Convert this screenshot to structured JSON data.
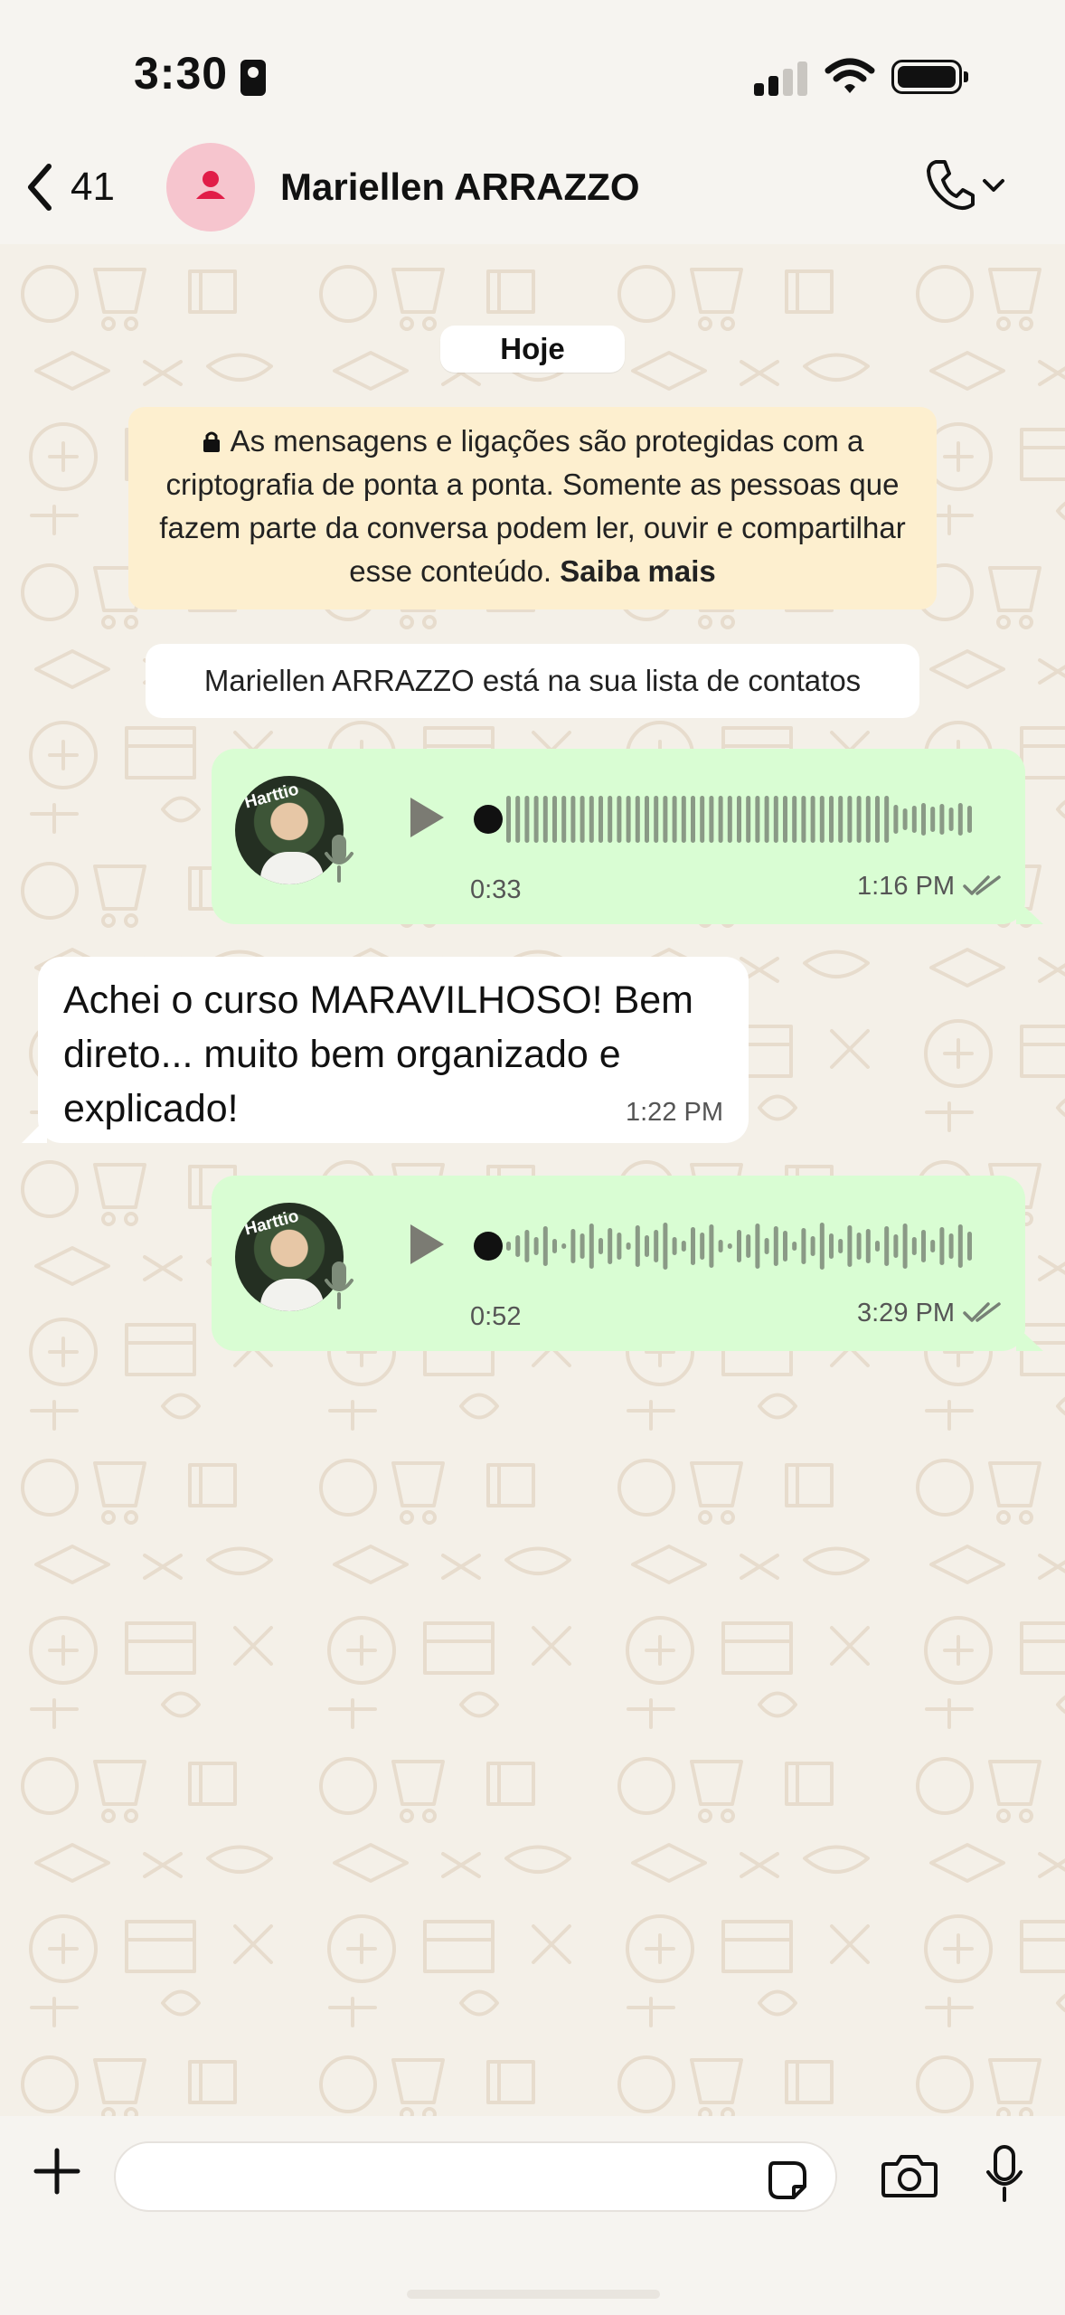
{
  "status_bar": {
    "time": "3:30"
  },
  "header": {
    "back_count": "41",
    "contact_name": "Mariellen ARRAZZO",
    "call_icon": "phone-icon",
    "menu_icon": "chevron-down-icon"
  },
  "chat": {
    "date_chip": "Hoje",
    "encryption_notice": {
      "text": "As mensagens e ligações são protegidas com a criptografia de ponta a ponta. Somente as pessoas que fazem parte da conversa podem ler, ouvir e compartilhar esse conteúdo.",
      "link": "Saiba mais"
    },
    "contact_notice": "Mariellen ARRAZZO está na sua lista de contatos",
    "messages": [
      {
        "type": "voice",
        "direction": "outgoing",
        "duration": "0:33",
        "time": "1:16 PM",
        "status": "read-ticks"
      },
      {
        "type": "text",
        "direction": "incoming",
        "text": "Achei o curso MARAVILHOSO! Bem direto... muito bem organizado e explicado!",
        "time": "1:22 PM"
      },
      {
        "type": "voice",
        "direction": "outgoing",
        "duration": "0:52",
        "time": "3:29 PM",
        "status": "read-ticks"
      }
    ]
  },
  "input_bar": {
    "plus_icon": "plus-icon",
    "sticker_icon": "sticker-icon",
    "camera_icon": "camera-icon",
    "mic_icon": "microphone-icon"
  },
  "colors": {
    "outgoing_bubble": "#d9fdd3",
    "incoming_bubble": "#ffffff",
    "notice_bg": "#fdefcf",
    "avatar_bg": "#f6c5ce",
    "avatar_icon": "#e11d48"
  }
}
